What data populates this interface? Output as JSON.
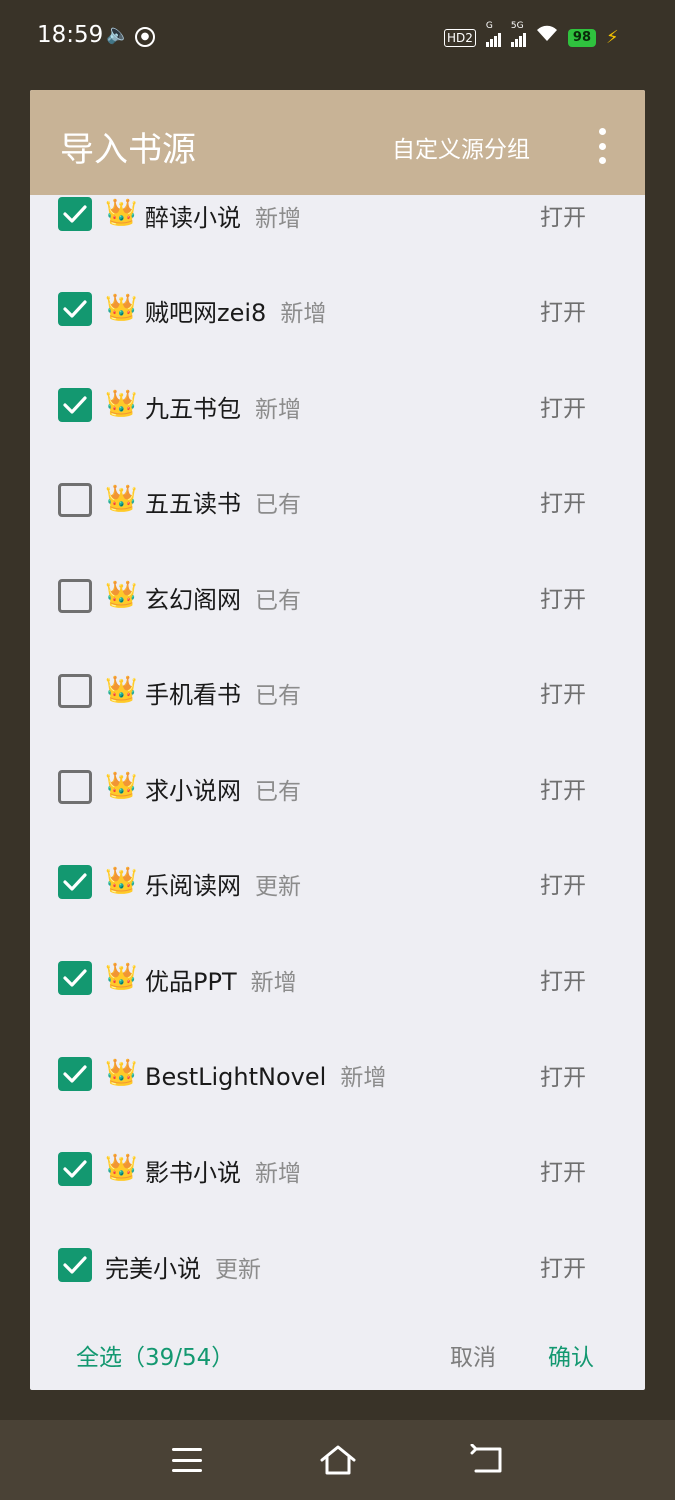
{
  "status_bar": {
    "time": "18:59",
    "hd_label": "HD2",
    "signal1_label": "G",
    "signal2_label": "5G",
    "battery": "98",
    "icons": [
      "volume-icon",
      "cast-icon",
      "signal-icon",
      "wifi-icon",
      "battery-icon",
      "charging-icon"
    ]
  },
  "dialog": {
    "title": "导入书源",
    "group_button": "自定义源分组",
    "menu_icon": "more-vertical-icon"
  },
  "sources": [
    {
      "checked": true,
      "crown": true,
      "name": "醉读小说",
      "status": "新增",
      "action": "打开"
    },
    {
      "checked": true,
      "crown": true,
      "name": "贼吧网zei8",
      "status": "新增",
      "action": "打开"
    },
    {
      "checked": true,
      "crown": true,
      "name": "九五书包",
      "status": "新增",
      "action": "打开"
    },
    {
      "checked": false,
      "crown": true,
      "name": "五五读书",
      "status": "已有",
      "action": "打开"
    },
    {
      "checked": false,
      "crown": true,
      "name": "玄幻阁网",
      "status": "已有",
      "action": "打开"
    },
    {
      "checked": false,
      "crown": true,
      "name": "手机看书",
      "status": "已有",
      "action": "打开"
    },
    {
      "checked": false,
      "crown": true,
      "name": "求小说网",
      "status": "已有",
      "action": "打开"
    },
    {
      "checked": true,
      "crown": true,
      "name": "乐阅读网",
      "status": "更新",
      "action": "打开"
    },
    {
      "checked": true,
      "crown": true,
      "name": "优品PPT",
      "status": "新增",
      "action": "打开"
    },
    {
      "checked": true,
      "crown": true,
      "name": "BestLightNovel",
      "status": "新增",
      "action": "打开"
    },
    {
      "checked": true,
      "crown": true,
      "name": "影书小说",
      "status": "新增",
      "action": "打开"
    },
    {
      "checked": true,
      "crown": false,
      "name": "完美小说",
      "status": "更新",
      "action": "打开"
    }
  ],
  "footer": {
    "select_all": "全选（39/54）",
    "cancel": "取消",
    "confirm": "确认"
  },
  "colors": {
    "header": "#c8b396",
    "accent": "#139870",
    "dialog_bg": "#eeeef3",
    "backdrop": "#393328"
  },
  "navbar": {
    "icons": [
      "menu-icon",
      "home-icon",
      "back-icon"
    ]
  }
}
